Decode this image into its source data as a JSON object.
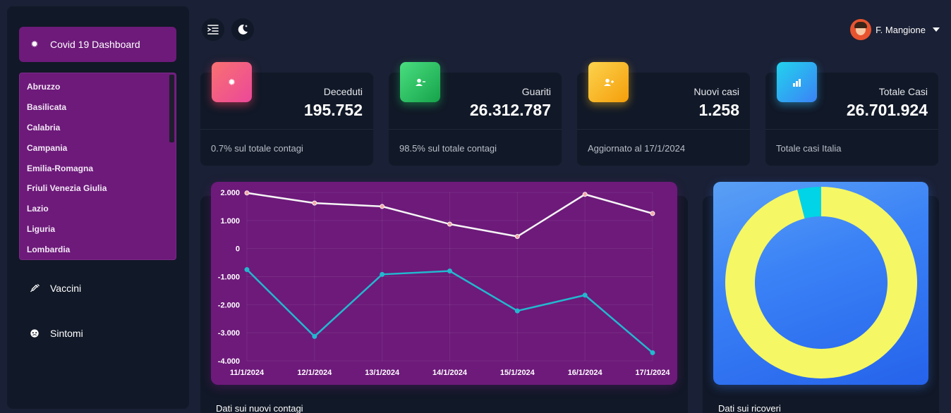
{
  "sidebar": {
    "active_item": {
      "label": "Covid 19 Dashboard",
      "icon": "virus-icon"
    },
    "regions": [
      "Abruzzo",
      "Basilicata",
      "Calabria",
      "Campania",
      "Emilia-Romagna",
      "Friuli Venezia Giulia",
      "Lazio",
      "Liguria",
      "Lombardia"
    ],
    "items": [
      {
        "label": "Vaccini",
        "icon": "syringe-icon"
      },
      {
        "label": "Sintomi",
        "icon": "head-icon"
      }
    ]
  },
  "header": {
    "user_name": "F. Mangione"
  },
  "cards": [
    {
      "title": "Deceduti",
      "value": "195.752",
      "footer": "0.7% sul totale contagi",
      "icon": "virus-icon",
      "color": "#f43f5e"
    },
    {
      "title": "Guariti",
      "value": "26.312.787",
      "footer": "98.5% sul totale contagi",
      "icon": "user-check-icon",
      "color": "#22c55e"
    },
    {
      "title": "Nuovi casi",
      "value": "1.258",
      "footer": "Aggiornato al 17/1/2024",
      "icon": "user-plus-icon",
      "color": "#fbbf24"
    },
    {
      "title": "Totale Casi",
      "value": "26.701.924",
      "footer": "Totale casi Italia",
      "icon": "bar-chart-icon",
      "color": "#38bdf8"
    }
  ],
  "panels": {
    "line_title": "Dati sui nuovi contagi",
    "donut_title": "Dati sui ricoveri"
  },
  "chart_data": [
    {
      "type": "line",
      "x": [
        "11/1/2024",
        "12/1/2024",
        "13/1/2024",
        "14/1/2024",
        "15/1/2024",
        "16/1/2024",
        "17/1/2024"
      ],
      "yticks": [
        "2.000",
        "1.000",
        "0",
        "-1.000",
        "-2.000",
        "-3.000",
        "-4.000"
      ],
      "ylim": [
        -4000,
        2000
      ],
      "series": [
        {
          "values": [
            1980,
            1620,
            1500,
            870,
            430,
            1930,
            1250
          ],
          "color": "#f5f5f5"
        },
        {
          "values": [
            -750,
            -3130,
            -920,
            -800,
            -2220,
            -1660,
            -3710
          ],
          "color": "#22b8cf"
        }
      ],
      "grid": true
    },
    {
      "type": "pie",
      "donut": true,
      "values": [
        96,
        4
      ],
      "colors": [
        "#f5f765",
        "#00d4e6"
      ]
    }
  ]
}
